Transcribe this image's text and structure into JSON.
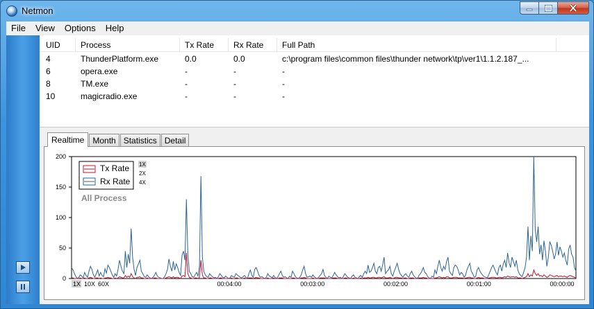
{
  "window": {
    "title": "Netmon"
  },
  "menu": [
    "File",
    "View",
    "Options",
    "Help"
  ],
  "process_table": {
    "columns": [
      "UID",
      "Process",
      "Tx Rate",
      "Rx Rate",
      "Full Path"
    ],
    "rows": [
      [
        "4",
        "ThunderPlatform.exe",
        "0.0",
        "0.0",
        "c:\\program files\\common files\\thunder network\\tp\\ver1\\1.1.2.187_..."
      ],
      [
        "6",
        "opera.exe",
        "-",
        "-",
        "-"
      ],
      [
        "8",
        "TM.exe",
        "-",
        "-",
        "-"
      ],
      [
        "10",
        "magicradio.exe",
        "-",
        "-",
        "-"
      ]
    ]
  },
  "tabs": [
    "Realtime",
    "Month",
    "Statistics",
    "Detail"
  ],
  "active_tab": "Realtime",
  "chart_data": {
    "type": "line",
    "overlay_label": "All Process",
    "y_ticks": [
      "200",
      "150",
      "100",
      "50",
      "0"
    ],
    "ylim": [
      0,
      200
    ],
    "x_ticks": [
      "00:04:00",
      "00:03:00",
      "00:02:00",
      "00:01:00",
      "00:00:00"
    ],
    "y_scale_options": [
      "1X",
      "2X",
      "4X"
    ],
    "y_scale_selected": "1X",
    "x_scale_options": [
      "1X",
      "10X",
      "60X"
    ],
    "x_scale_selected": "1X",
    "grid": false,
    "legend_position": "top-left",
    "legend": [
      {
        "name": "Tx Rate",
        "color": "#c0142d"
      },
      {
        "name": "Rx Rate",
        "color": "#2a6496"
      }
    ],
    "series": [
      {
        "name": "Rx Rate",
        "color": "#2a6496",
        "values": [
          18,
          14,
          8,
          3,
          0,
          2,
          6,
          4,
          1,
          10,
          5,
          2,
          12,
          20,
          15,
          6,
          2,
          8,
          14,
          4,
          10,
          5,
          3,
          16,
          9,
          22,
          18,
          12,
          6,
          2,
          8,
          4,
          15,
          30,
          20,
          12,
          8,
          45,
          18,
          40,
          25,
          82,
          35,
          15,
          5,
          18,
          24,
          30,
          12,
          8,
          3,
          2,
          6,
          3,
          1,
          0,
          2,
          5,
          10,
          4,
          2,
          1,
          0,
          0,
          3,
          8,
          15,
          32,
          20,
          12,
          28,
          14,
          24,
          18,
          10,
          5,
          38,
          45,
          30,
          130,
          40,
          12,
          8,
          3,
          2,
          6,
          10,
          4,
          20,
          168,
          35,
          12,
          6,
          3,
          2,
          8,
          5,
          3,
          1,
          2,
          0,
          3,
          8,
          5,
          2,
          1,
          4,
          2,
          0,
          1,
          5,
          3,
          2,
          8,
          6,
          4,
          2,
          1,
          3,
          5,
          2,
          0,
          8,
          14,
          5,
          2,
          15,
          18,
          12,
          5,
          2,
          3,
          1,
          0,
          2,
          8,
          4,
          3,
          1,
          5,
          2,
          0,
          3,
          8,
          12,
          5,
          2,
          3,
          1,
          0,
          4,
          2,
          12,
          8,
          3,
          1,
          0,
          2,
          6,
          14,
          20,
          8,
          2,
          3,
          4,
          2,
          6,
          3,
          1,
          0,
          2,
          5,
          8,
          15,
          5,
          2,
          0,
          4,
          2,
          1,
          5,
          10,
          6,
          3,
          1,
          2,
          0,
          3,
          8,
          5,
          2,
          1,
          0,
          4,
          6,
          2,
          1,
          0,
          3,
          5,
          2,
          8,
          12,
          8,
          22,
          10,
          12,
          18,
          25,
          12,
          8,
          18,
          20,
          12,
          22,
          35,
          8,
          12,
          14,
          20,
          8,
          4,
          12,
          18,
          25,
          15,
          8,
          5,
          2,
          6,
          8,
          4,
          2,
          8,
          12,
          6,
          3,
          1,
          0,
          5,
          8,
          12,
          18,
          10,
          8,
          3,
          1,
          0,
          4,
          2,
          14,
          8,
          20,
          30,
          18,
          12,
          20,
          15,
          28,
          35,
          12,
          8,
          5,
          18,
          22,
          20,
          14,
          6,
          10,
          8,
          2,
          5,
          14,
          20,
          25,
          12,
          8,
          2,
          3,
          14,
          18,
          12,
          8,
          5,
          3,
          2,
          1,
          6,
          12,
          18,
          22,
          16,
          10,
          6,
          18,
          22,
          12,
          24,
          30,
          18,
          42,
          26,
          18,
          35,
          28,
          20,
          30,
          14,
          8,
          5,
          3,
          10,
          18,
          35,
          85,
          30,
          70,
          45,
          200,
          80,
          60,
          85,
          40,
          55,
          30,
          62,
          45,
          20,
          35,
          60,
          55,
          45,
          32,
          40,
          60,
          38,
          52,
          45,
          35,
          42,
          30,
          22,
          48,
          55,
          40,
          35,
          18,
          12
        ]
      },
      {
        "name": "Tx Rate",
        "color": "#c0142d",
        "values": [
          1,
          1,
          0,
          0,
          0,
          0,
          1,
          0,
          0,
          1,
          0,
          0,
          1,
          2,
          1,
          0,
          0,
          1,
          1,
          0,
          1,
          0,
          0,
          1,
          1,
          2,
          1,
          1,
          0,
          0,
          1,
          0,
          1,
          3,
          2,
          1,
          1,
          5,
          2,
          4,
          2,
          8,
          3,
          1,
          0,
          2,
          2,
          3,
          1,
          1,
          0,
          0,
          1,
          0,
          0,
          0,
          0,
          1,
          1,
          0,
          0,
          0,
          0,
          0,
          0,
          1,
          2,
          3,
          2,
          1,
          3,
          1,
          2,
          2,
          1,
          0,
          4,
          5,
          3,
          42,
          8,
          2,
          1,
          0,
          0,
          1,
          1,
          0,
          2,
          30,
          6,
          1,
          1,
          0,
          0,
          1,
          1,
          0,
          0,
          0,
          0,
          0,
          1,
          1,
          0,
          0,
          0,
          0,
          0,
          0,
          1,
          0,
          0,
          1,
          1,
          0,
          0,
          0,
          0,
          1,
          0,
          0,
          1,
          1,
          1,
          0,
          1,
          2,
          1,
          1,
          0,
          0,
          0,
          0,
          0,
          1,
          0,
          0,
          0,
          1,
          0,
          0,
          0,
          1,
          1,
          1,
          0,
          0,
          0,
          0,
          0,
          0,
          1,
          1,
          0,
          0,
          0,
          0,
          1,
          1,
          2,
          1,
          0,
          0,
          0,
          0,
          1,
          0,
          0,
          0,
          0,
          1,
          1,
          1,
          1,
          0,
          0,
          0,
          0,
          0,
          1,
          1,
          1,
          0,
          0,
          0,
          0,
          0,
          1,
          1,
          0,
          0,
          0,
          0,
          1,
          0,
          0,
          0,
          0,
          1,
          0,
          1,
          1,
          1,
          2,
          1,
          1,
          2,
          2,
          1,
          1,
          2,
          2,
          1,
          2,
          3,
          1,
          1,
          1,
          2,
          1,
          0,
          1,
          2,
          2,
          1,
          1,
          1,
          0,
          1,
          1,
          0,
          0,
          1,
          1,
          1,
          0,
          0,
          0,
          1,
          1,
          1,
          2,
          1,
          1,
          0,
          0,
          0,
          0,
          0,
          1,
          1,
          2,
          3,
          2,
          1,
          2,
          1,
          3,
          3,
          1,
          1,
          1,
          2,
          2,
          2,
          1,
          1,
          1,
          1,
          0,
          1,
          1,
          2,
          2,
          1,
          1,
          0,
          0,
          1,
          2,
          1,
          1,
          1,
          0,
          0,
          0,
          1,
          1,
          2,
          2,
          2,
          1,
          1,
          2,
          2,
          1,
          2,
          3,
          2,
          4,
          3,
          2,
          3,
          3,
          2,
          3,
          1,
          1,
          1,
          0,
          1,
          2,
          3,
          8,
          3,
          6,
          4,
          14,
          8,
          5,
          8,
          4,
          5,
          3,
          6,
          4,
          2,
          3,
          6,
          5,
          4,
          3,
          4,
          5,
          3,
          4,
          4,
          3,
          4,
          3,
          2,
          4,
          5,
          4,
          3,
          2,
          1
        ]
      }
    ]
  }
}
